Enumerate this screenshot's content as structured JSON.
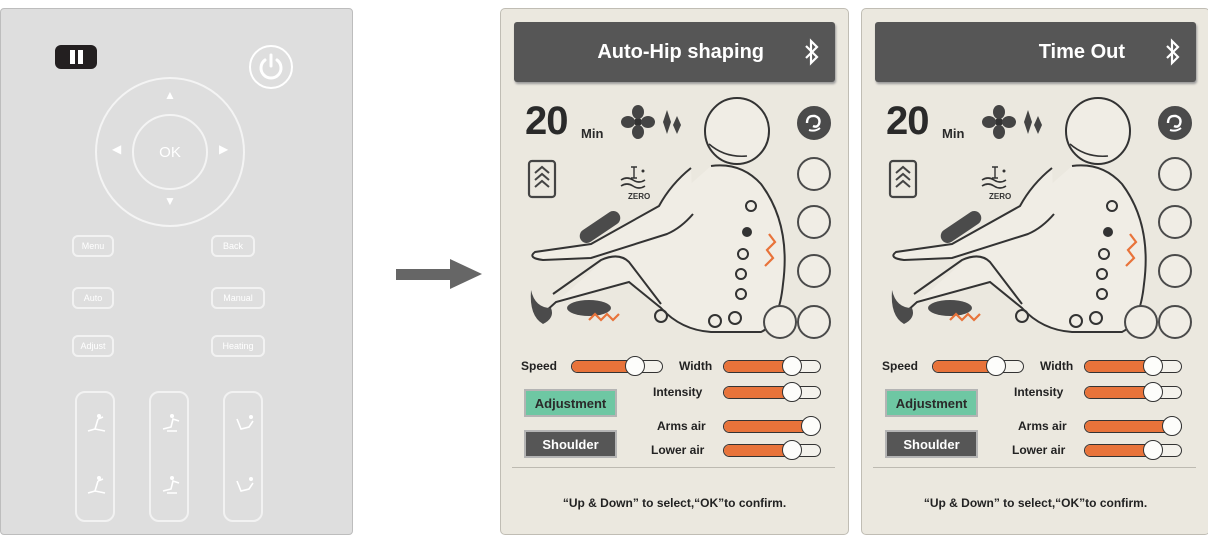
{
  "remote": {
    "ok_label": "OK",
    "buttons": {
      "menu": "Menu",
      "back": "Back",
      "auto": "Auto",
      "manual": "Manual",
      "adjust": "Adjust",
      "heating": "Heating"
    },
    "icons": [
      "pause-icon",
      "power-icon",
      "arrow-up-icon",
      "arrow-down-icon",
      "arrow-left-icon",
      "arrow-right-icon",
      "recline-up-icon",
      "recline-down-icon",
      "foot-massage-icon",
      "legrest-icon"
    ]
  },
  "arrow_icon": "right-arrow-icon",
  "panels": [
    {
      "title": "Auto-Hip shaping",
      "timer": "20",
      "timer_unit": "Min",
      "zero_label": "ZERO",
      "sliders": {
        "speed": {
          "label": "Speed",
          "level": 0.75
        },
        "width": {
          "label": "Width",
          "level": 0.75
        },
        "intensity": {
          "label": "Intensity",
          "level": 0.75
        },
        "arms_air": {
          "label": "Arms air",
          "level": 1.0
        },
        "lower_air": {
          "label": "Lower air",
          "level": 0.75
        }
      },
      "buttons": {
        "adjustment": "Adjustment",
        "shoulder": "Shoulder"
      },
      "footer": "“Up & Down” to select,“OK”to confirm."
    },
    {
      "title": "Time Out",
      "timer": "20",
      "timer_unit": "Min",
      "zero_label": "ZERO",
      "sliders": {
        "speed": {
          "label": "Speed",
          "level": 0.75
        },
        "width": {
          "label": "Width",
          "level": 0.75
        },
        "intensity": {
          "label": "Intensity",
          "level": 0.75
        },
        "arms_air": {
          "label": "Arms air",
          "level": 1.0
        },
        "lower_air": {
          "label": "Lower air",
          "level": 0.75
        }
      },
      "buttons": {
        "adjustment": "Adjustment",
        "shoulder": "Shoulder"
      },
      "footer": "“Up & Down” to select,“OK”to confirm."
    }
  ],
  "colors": {
    "accent": "#e8733a",
    "title_bar": "#565656",
    "adjust_button": "#6ec7a3",
    "panel_bg": "#ebe8df",
    "remote_bg": "#dedede"
  }
}
